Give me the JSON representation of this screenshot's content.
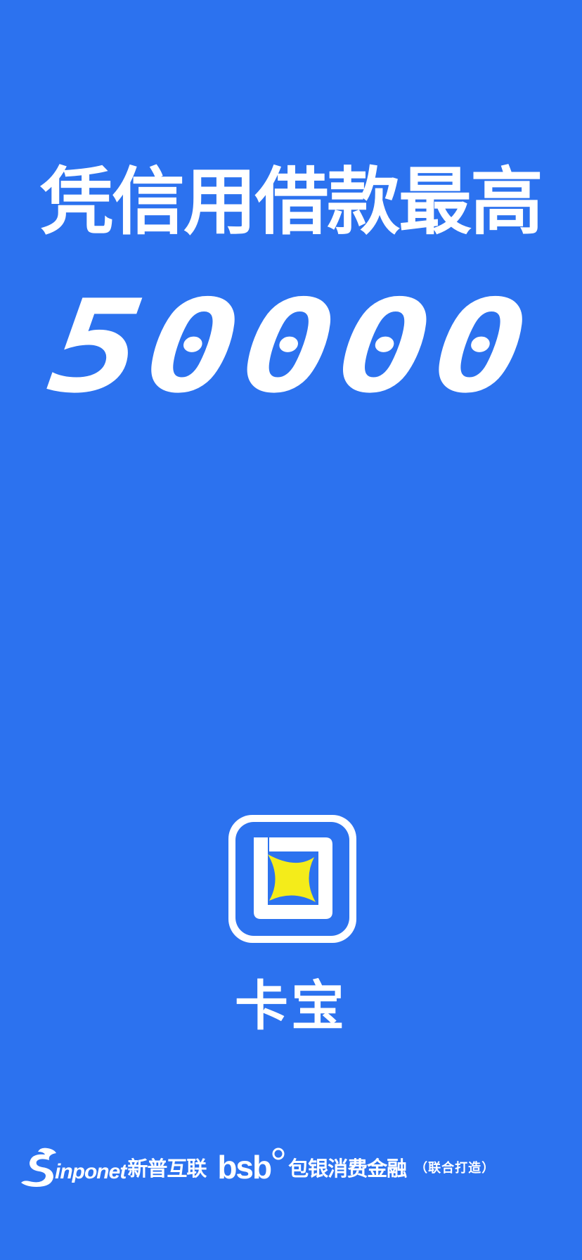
{
  "promo": {
    "headline": "凭信用借款最高",
    "amount": "50000"
  },
  "app": {
    "name": "卡宝",
    "logo_icon": "kabao-app-logo-icon"
  },
  "partners": {
    "sinponet_name": "inponet",
    "sinponet_cn": "新普互联",
    "bsb_name": "bsb",
    "bsb_cn": "包银消费金融",
    "note": "（联合打造）"
  },
  "colors": {
    "background": "#2c72ef",
    "text": "#ffffff",
    "logo_star": "#f4ec1a"
  }
}
